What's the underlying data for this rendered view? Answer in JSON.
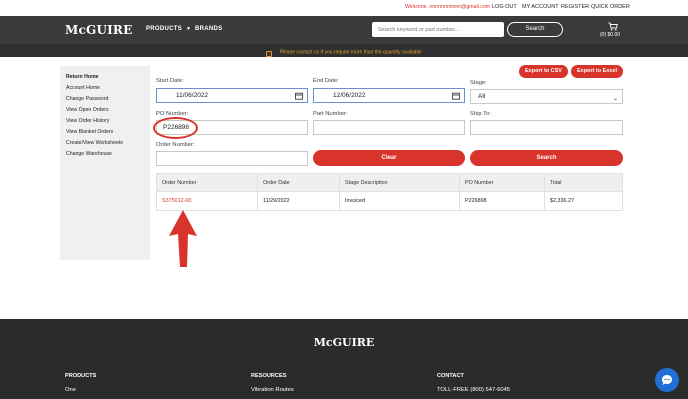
{
  "topbar": {
    "welcome": "Welcome, nnnnnnnnnnn@gmail.com",
    "logout": "LOG OUT",
    "my_account": "MY ACCOUNT",
    "register": "REGISTER",
    "quick_order": "QUICK ORDER"
  },
  "header": {
    "logo": "McGUIRE",
    "nav_products": "PRODUCTS",
    "nav_brands": "BRANDS",
    "search_placeholder": "Search keyword or part number...",
    "search_button": "Search",
    "cart": "(0) $0.00"
  },
  "notice": {
    "text": "Please contact us if you require more than the quantity available"
  },
  "sidebar": {
    "items": [
      {
        "label": "Return Home"
      },
      {
        "label": "Account Home"
      },
      {
        "label": "Change Password"
      },
      {
        "label": "View Open Orders"
      },
      {
        "label": "View Order History"
      },
      {
        "label": "View Blanket Orders"
      },
      {
        "label": "Create/View Worksheets"
      },
      {
        "label": "Change Warehouse"
      }
    ]
  },
  "actions": {
    "export_csv": "Export to CSV",
    "export_excel": "Export to Excel"
  },
  "filters": {
    "start_date_label": "Start Date:",
    "start_date_value": "11/06/2022",
    "end_date_label": "End Date:",
    "end_date_value": "12/06/2022",
    "stage_label": "Stage:",
    "stage_value": "All",
    "po_label": "PO Number:",
    "po_value": "P226898",
    "part_label": "Part Number:",
    "ship_label": "Ship To:",
    "order_label": "Order Number:",
    "clear_button": "Clear",
    "search_button": "Search"
  },
  "table": {
    "headers": [
      "Order Number",
      "Order Date",
      "Stage Description",
      "PO Number",
      "Total"
    ],
    "rows": [
      [
        "S375012-00",
        "11/29/2022",
        "Invoiced",
        "P226898",
        "$2,336.27"
      ]
    ]
  },
  "footer": {
    "logo": "McGUIRE",
    "col1_heading": "PRODUCTS",
    "col1_link": "One",
    "col2_heading": "RESOURCES",
    "col2_link": "Vibration Routes",
    "col3_heading": "CONTACT",
    "col3_link": "TOLL-FREE (800) 547-6045"
  },
  "colors": {
    "brand_red": "#d9342b",
    "header_dark": "#3a3a3a",
    "notice_text": "#e0a12a",
    "chat_blue": "#1f6fd6"
  }
}
